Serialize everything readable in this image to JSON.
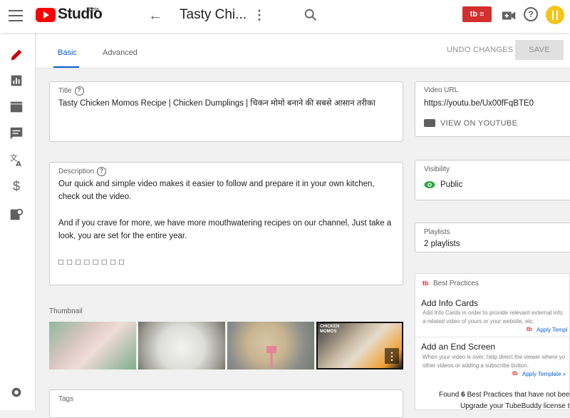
{
  "topbar": {
    "studio_label": "Studio",
    "beta_label": "beta",
    "video_title": "Tasty Chi...",
    "tb_label": "tb ≡"
  },
  "tabs": {
    "basic": "Basic",
    "advanced": "Advanced"
  },
  "actions": {
    "undo": "UNDO CHANGES",
    "save": "SAVE"
  },
  "title_field": {
    "label": "Title",
    "value": "Tasty Chicken Momos Recipe | Chicken Dumplings | चिकन मोमो बनाने की सबसे आसान तरीका"
  },
  "description_field": {
    "label": "Description",
    "line1": "Our quick and simple video makes it easier to follow and prepare it in your own kitchen,",
    "line2": "check out the video.",
    "line3": "And if you crave for more, we have more mouthwatering recipes on our channel, Just take a",
    "line4": "look, you are set for the entire year.",
    "line5": "□ □ □ □ □ □ □ □"
  },
  "thumbnail_label": "Thumbnail",
  "thumb_caption": "CHICKEN MOMOS",
  "tags_label": "Tags",
  "video_url": {
    "label": "Video URL",
    "value": "https://youtu.be/Ux00fFqBTE0",
    "view_label": "VIEW ON YOUTUBE"
  },
  "visibility": {
    "label": "Visibility",
    "value": "Public"
  },
  "playlists": {
    "label": "Playlists",
    "value": "2 playlists"
  },
  "best_practices": {
    "header_logo": "tb",
    "header": "Best Practices",
    "item1_title": "Add Info Cards",
    "item1_desc1": "Add Info Cards in order to provide relevant external info",
    "item1_desc2": "a related video of yours or your website, etc.",
    "item1_link": "Apply Templ",
    "item2_title": "Add an End Screen",
    "item2_desc1": "When your video is over, help direct the viewer where yo",
    "item2_desc2": "other videos or adding a subscribe button.",
    "item2_link": "Apply Template »",
    "found_pre": "Found ",
    "found_count": "6",
    "found_post": " Best Practices that have not bee",
    "upgrade": "Upgrade your TubeBuddy license t"
  },
  "colors": {
    "accent": "#065fd4",
    "brand_red": "#ff0000",
    "tb_red": "#d32f2f",
    "public_green": "#2ba640"
  }
}
